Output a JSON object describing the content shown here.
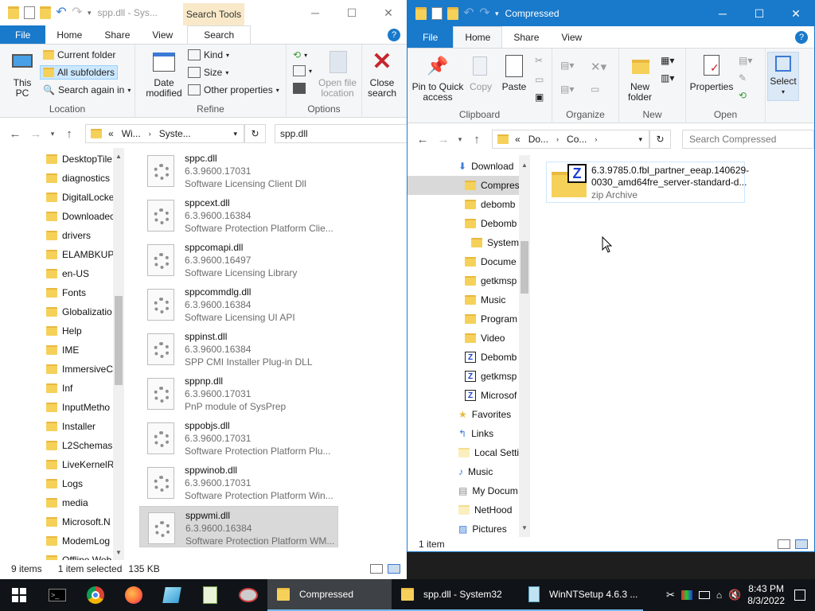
{
  "window_left": {
    "title": "spp.dll - Sys...",
    "context_tab": "Search Tools",
    "tabs": [
      "File",
      "Home",
      "Share",
      "View",
      "Search"
    ],
    "ribbon": {
      "this_pc": "This PC",
      "current_folder": "Current folder",
      "all_subfolders": "All subfolders",
      "search_again_in": "Search again in",
      "location_label": "Location",
      "date_modified": "Date modified",
      "kind": "Kind",
      "size": "Size",
      "other_properties": "Other properties",
      "refine_label": "Refine",
      "open_file_location": "Open file location",
      "options_label": "Options",
      "close_search": "Close search"
    },
    "address": {
      "part1": "Wi...",
      "part2": "Syste..."
    },
    "search_value": "spp.dll",
    "nav_items": [
      "DesktopTile",
      "diagnostics",
      "DigitalLocke",
      "Downloadec",
      "drivers",
      "ELAMBKUP",
      "en-US",
      "Fonts",
      "Globalizatio",
      "Help",
      "IME",
      "ImmersiveC",
      "Inf",
      "InputMetho",
      "Installer",
      "L2Schemas",
      "LiveKernelR",
      "Logs",
      "media",
      "Microsoft.N",
      "ModemLog",
      "Offline Web"
    ],
    "files": [
      {
        "name": "sppc.dll",
        "version": "6.3.9600.17031",
        "desc": "Software Licensing Client Dll"
      },
      {
        "name": "sppcext.dll",
        "version": "6.3.9600.16384",
        "desc": "Software Protection Platform Clie..."
      },
      {
        "name": "sppcomapi.dll",
        "version": "6.3.9600.16497",
        "desc": "Software Licensing Library"
      },
      {
        "name": "sppcommdlg.dll",
        "version": "6.3.9600.16384",
        "desc": "Software Licensing UI API"
      },
      {
        "name": "sppinst.dll",
        "version": "6.3.9600.16384",
        "desc": "SPP CMI Installer Plug-in DLL"
      },
      {
        "name": "sppnp.dll",
        "version": "6.3.9600.17031",
        "desc": "PnP module of SysPrep"
      },
      {
        "name": "sppobjs.dll",
        "version": "6.3.9600.17031",
        "desc": "Software Protection Platform Plu..."
      },
      {
        "name": "sppwinob.dll",
        "version": "6.3.9600.17031",
        "desc": "Software Protection Platform Win..."
      },
      {
        "name": "sppwmi.dll",
        "version": "6.3.9600.16384",
        "desc": "Software Protection Platform WM..."
      }
    ],
    "status": {
      "items": "9 items",
      "selected": "1 item selected",
      "size": "135 KB"
    }
  },
  "window_right": {
    "title": "Compressed",
    "tabs": [
      "File",
      "Home",
      "Share",
      "View"
    ],
    "ribbon": {
      "pin": "Pin to Quick access",
      "copy": "Copy",
      "paste": "Paste",
      "clipboard_label": "Clipboard",
      "organize_label": "Organize",
      "new_folder": "New folder",
      "new_label": "New",
      "properties": "Properties",
      "open_label": "Open",
      "select": "Select"
    },
    "address": {
      "part1": "Do...",
      "part2": "Co..."
    },
    "search_placeholder": "Search Compressed",
    "nav_items": [
      {
        "label": "Download",
        "type": "download"
      },
      {
        "label": "Compres",
        "type": "folder"
      },
      {
        "label": "debomb",
        "type": "folder"
      },
      {
        "label": "Debomb",
        "type": "folder"
      },
      {
        "label": "System",
        "type": "folder"
      },
      {
        "label": "Docume",
        "type": "folder"
      },
      {
        "label": "getkmsp",
        "type": "folder"
      },
      {
        "label": "Music",
        "type": "folder"
      },
      {
        "label": "Program",
        "type": "folder"
      },
      {
        "label": "Video",
        "type": "folder"
      },
      {
        "label": "Debomb",
        "type": "zip"
      },
      {
        "label": "getkmsp",
        "type": "zip"
      },
      {
        "label": "Microsof",
        "type": "zip"
      },
      {
        "label": "Favorites",
        "type": "star"
      },
      {
        "label": "Links",
        "type": "links"
      },
      {
        "label": "Local Setti",
        "type": "plain"
      },
      {
        "label": "Music",
        "type": "music"
      },
      {
        "label": "My Docum",
        "type": "doc"
      },
      {
        "label": "NetHood",
        "type": "plain"
      },
      {
        "label": "Pictures",
        "type": "pictures"
      }
    ],
    "file": {
      "name1": "6.3.9785.0.fbl_partner_eeap.140629-",
      "name2": "0030_amd64fre_server-standard-d...",
      "type": "zip Archive"
    },
    "status": {
      "items": "1 item"
    }
  },
  "taskbar": {
    "apps": [
      {
        "label": "Compressed",
        "active": true
      },
      {
        "label": "spp.dll - System32",
        "active": false
      },
      {
        "label": "WinNTSetup 4.6.3 ...",
        "active": false
      }
    ],
    "time": "8:43 PM",
    "date": "8/3/2022"
  }
}
